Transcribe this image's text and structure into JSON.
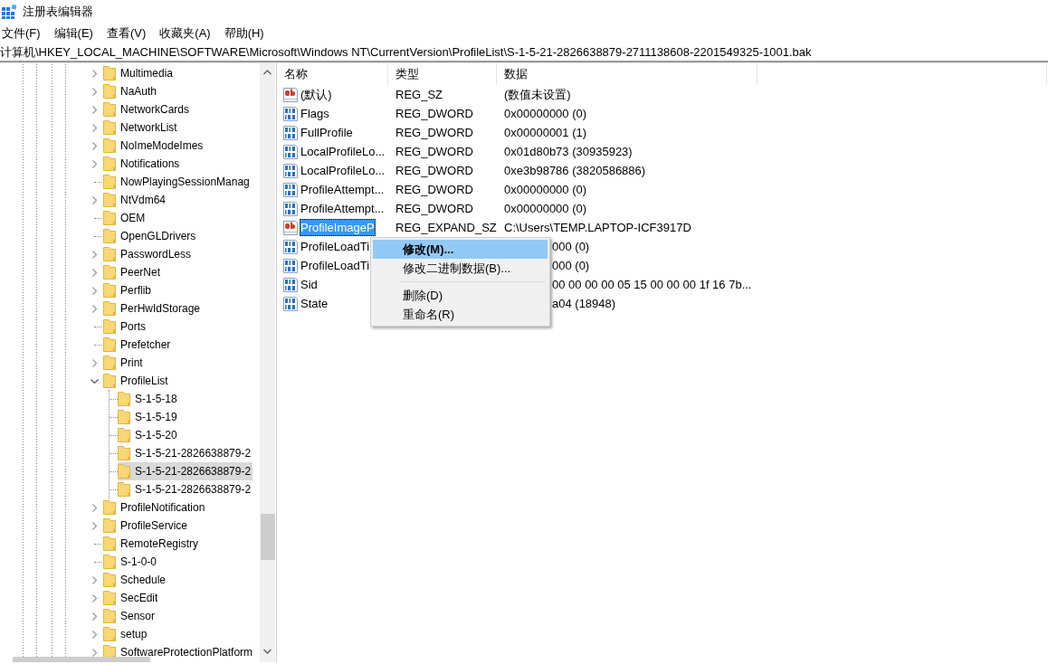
{
  "window": {
    "title": "注册表编辑器"
  },
  "menu_bar": [
    "文件(F)",
    "编辑(E)",
    "查看(V)",
    "收藏夹(A)",
    "帮助(H)"
  ],
  "address": "计算机\\HKEY_LOCAL_MACHINE\\SOFTWARE\\Microsoft\\Windows NT\\CurrentVersion\\ProfileList\\S-1-5-21-2826638879-2711138608-2201549325-1001.bak",
  "tree": [
    {
      "label": "Multimedia",
      "expandable": true,
      "selected": false
    },
    {
      "label": "NaAuth",
      "expandable": true,
      "selected": false
    },
    {
      "label": "NetworkCards",
      "expandable": true,
      "selected": false
    },
    {
      "label": "NetworkList",
      "expandable": true,
      "selected": false
    },
    {
      "label": "NoImeModeImes",
      "expandable": true,
      "selected": false
    },
    {
      "label": "Notifications",
      "expandable": true,
      "selected": false
    },
    {
      "label": "NowPlayingSessionManag",
      "expandable": false,
      "selected": false
    },
    {
      "label": "NtVdm64",
      "expandable": true,
      "selected": false
    },
    {
      "label": "OEM",
      "expandable": false,
      "selected": false
    },
    {
      "label": "OpenGLDrivers",
      "expandable": false,
      "selected": false
    },
    {
      "label": "PasswordLess",
      "expandable": true,
      "selected": false
    },
    {
      "label": "PeerNet",
      "expandable": true,
      "selected": false
    },
    {
      "label": "Perflib",
      "expandable": true,
      "selected": false
    },
    {
      "label": "PerHwIdStorage",
      "expandable": true,
      "selected": false
    },
    {
      "label": "Ports",
      "expandable": false,
      "selected": false
    },
    {
      "label": "Prefetcher",
      "expandable": false,
      "selected": false
    },
    {
      "label": "Print",
      "expandable": true,
      "selected": false
    },
    {
      "label": "ProfileList",
      "expandable": true,
      "expanded": true,
      "selected": false,
      "children": [
        {
          "label": "S-1-5-18",
          "selected": false
        },
        {
          "label": "S-1-5-19",
          "selected": false
        },
        {
          "label": "S-1-5-20",
          "selected": false
        },
        {
          "label": "S-1-5-21-2826638879-2",
          "selected": false
        },
        {
          "label": "S-1-5-21-2826638879-2",
          "selected": true
        },
        {
          "label": "S-1-5-21-2826638879-2",
          "selected": false
        }
      ]
    },
    {
      "label": "ProfileNotification",
      "expandable": true,
      "selected": false
    },
    {
      "label": "ProfileService",
      "expandable": true,
      "selected": false
    },
    {
      "label": "RemoteRegistry",
      "expandable": false,
      "selected": false
    },
    {
      "label": "S-1-0-0",
      "expandable": false,
      "selected": false
    },
    {
      "label": "Schedule",
      "expandable": true,
      "selected": false
    },
    {
      "label": "SecEdit",
      "expandable": true,
      "selected": false
    },
    {
      "label": "Sensor",
      "expandable": true,
      "selected": false
    },
    {
      "label": "setup",
      "expandable": true,
      "selected": false
    },
    {
      "label": "SoftwareProtectionPlatform",
      "expandable": true,
      "selected": false
    }
  ],
  "table": {
    "columns": [
      "名称",
      "类型",
      "数据"
    ],
    "rows": [
      {
        "kind": "string",
        "name": "(默认)",
        "type": "REG_SZ",
        "data": "(数值未设置)",
        "selected": false
      },
      {
        "kind": "binary",
        "name": "Flags",
        "type": "REG_DWORD",
        "data": "0x00000000 (0)",
        "selected": false
      },
      {
        "kind": "binary",
        "name": "FullProfile",
        "type": "REG_DWORD",
        "data": "0x00000001 (1)",
        "selected": false
      },
      {
        "kind": "binary",
        "name": "LocalProfileLo...",
        "type": "REG_DWORD",
        "data": "0x01d80b73 (30935923)",
        "selected": false
      },
      {
        "kind": "binary",
        "name": "LocalProfileLo...",
        "type": "REG_DWORD",
        "data": "0xe3b98786 (3820586886)",
        "selected": false
      },
      {
        "kind": "binary",
        "name": "ProfileAttempt...",
        "type": "REG_DWORD",
        "data": "0x00000000 (0)",
        "selected": false
      },
      {
        "kind": "binary",
        "name": "ProfileAttempt...",
        "type": "REG_DWORD",
        "data": "0x00000000 (0)",
        "selected": false
      },
      {
        "kind": "string",
        "name": "ProfileImageP",
        "type": "REG_EXPAND_SZ",
        "data": "C:\\Users\\TEMP.LAPTOP-ICF3917D",
        "selected": true
      },
      {
        "kind": "binary",
        "name": "ProfileLoadTi",
        "data": "000 (0)",
        "selected": false
      },
      {
        "kind": "binary",
        "name": "ProfileLoadTi",
        "data": "000 (0)",
        "selected": false
      },
      {
        "kind": "binary",
        "name": "Sid",
        "data": "00 00 00 00 05 15 00 00 00 1f 16 7b...",
        "selected": false
      },
      {
        "kind": "binary",
        "name": "State",
        "data": "a04 (18948)",
        "selected": false
      }
    ]
  },
  "context_menu": [
    {
      "kind": "item",
      "label": "修改(M)...",
      "selected": true,
      "default": true
    },
    {
      "kind": "item",
      "label": "修改二进制数据(B)...",
      "selected": false,
      "default": false
    },
    {
      "kind": "separator"
    },
    {
      "kind": "item",
      "label": "删除(D)",
      "selected": false,
      "default": false
    },
    {
      "kind": "item",
      "label": "重命名(R)",
      "selected": false,
      "default": false
    }
  ]
}
